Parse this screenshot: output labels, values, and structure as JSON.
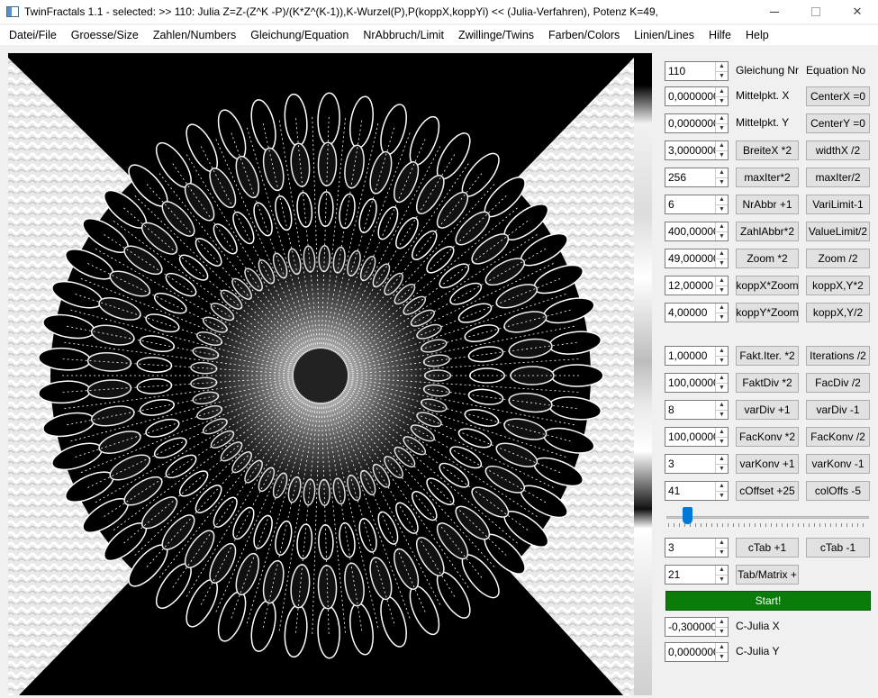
{
  "window": {
    "title": "TwinFractals 1.1 - selected: >> 110: Julia Z=Z-(Z^K -P)/(K*Z^(K-1)),K-Wurzel(P),P(koppX,koppYi)  << (Julia-Verfahren), Potenz K=49,"
  },
  "menu": [
    "Datei/File",
    "Groesse/Size",
    "Zahlen/Numbers",
    "Gleichung/Equation",
    "NrAbbruch/Limit",
    "Zwillinge/Twins",
    "Farben/Colors",
    "Linien/Lines",
    "Hilfe",
    "Help"
  ],
  "panel": {
    "r1": {
      "value": "110",
      "label": "Gleichung Nr",
      "label2": "Equation No"
    },
    "r2": {
      "value": "0,0000000",
      "label": "Mittelpkt. X",
      "btn2": "CenterX =0"
    },
    "r3": {
      "value": "0,0000000",
      "label": "Mittelpkt. Y",
      "btn2": "CenterY =0"
    },
    "r4": {
      "value": "3,0000000",
      "btn1": "BreiteX *2",
      "btn2": "widthX /2"
    },
    "r5": {
      "value": "256",
      "btn1": "maxIter*2",
      "btn2": "maxIter/2"
    },
    "r6": {
      "value": "6",
      "btn1": "NrAbbr +1",
      "btn2": "VariLimit-1"
    },
    "r7": {
      "value": "400,000000",
      "btn1": "ZahlAbbr*2",
      "btn2": "ValueLimit/2"
    },
    "r8": {
      "value": "49,000000",
      "btn1": "Zoom *2",
      "btn2": "Zoom /2"
    },
    "r9": {
      "value": "12,00000",
      "btn1": "koppX*Zoom",
      "btn2": "koppX,Y*2"
    },
    "r10": {
      "value": "4,00000",
      "btn1": "koppY*Zoom",
      "btn2": "koppX,Y/2"
    },
    "r11": {
      "value": "1,00000",
      "btn1": "Fakt.Iter. *2",
      "btn2": "Iterations /2"
    },
    "r12": {
      "value": "100,00000",
      "btn1": "FaktDiv *2",
      "btn2": "FacDiv /2"
    },
    "r13": {
      "value": "8",
      "btn1": "varDiv +1",
      "btn2": "varDiv -1"
    },
    "r14": {
      "value": "100,00000",
      "btn1": "FacKonv *2",
      "btn2": "FacKonv /2"
    },
    "r15": {
      "value": "3",
      "btn1": "varKonv +1",
      "btn2": "varKonv -1"
    },
    "r16": {
      "value": "41",
      "btn1": "cOffset +25",
      "btn2": "colOffs -5"
    },
    "r17": {
      "value": "3",
      "btn1": "cTab +1",
      "btn2": "cTab -1"
    },
    "r18": {
      "value": "21",
      "btn1": "Tab/Matrix +"
    },
    "start": "Start!",
    "r19": {
      "value": "-0,3000000",
      "label": "C-Julia X"
    },
    "r20": {
      "value": "0,0000000",
      "label": "C-Julia Y"
    },
    "slider_value": 0.08
  },
  "colors": {
    "start": "#0a7c0a",
    "accent": "#0078d7"
  }
}
